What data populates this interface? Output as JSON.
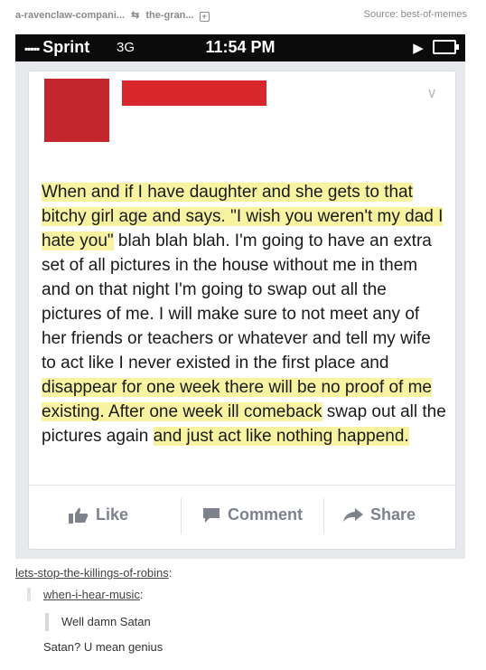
{
  "header": {
    "from_blog": "a-ravenclaw-compani...",
    "to_blog": "the-gran...",
    "source": "Source: best-of-memes"
  },
  "status_bar": {
    "carrier": "Sprint",
    "network": "3G",
    "time": "11:54 PM"
  },
  "post": {
    "segments": [
      {
        "text": "When and if I have daughter and she gets to that bitchy girl age and says. \"I wish you weren't my dad I hate you\"",
        "highlight": true
      },
      {
        "text": " blah blah blah. I'm going to have an extra set of all pictures in the house without me in them and on that night I'm going to swap out all the pictures of me. I will make sure to not meet any of her friends or teachers or whatever and tell my wife to act like I never existed in the first place and ",
        "highlight": false
      },
      {
        "text": "disappear for one week there will be no proof of me existing. After one week ill comeback",
        "highlight": true
      },
      {
        "text": " swap out all the pictures again ",
        "highlight": false
      },
      {
        "text": "and just act like nothing happend.",
        "highlight": true
      }
    ],
    "actions": {
      "like": "Like",
      "comment": "Comment",
      "share": "Share"
    }
  },
  "colors": {
    "highlight": "#f7f3a0",
    "redaction": "#d9262d",
    "status_bar": "#0b0b0b"
  },
  "thread": {
    "user1": "lets-stop-the-killings-of-robins",
    "user2": "when-i-hear-music",
    "quote": "Well damn Satan",
    "reply": "Satan? U mean genius"
  }
}
